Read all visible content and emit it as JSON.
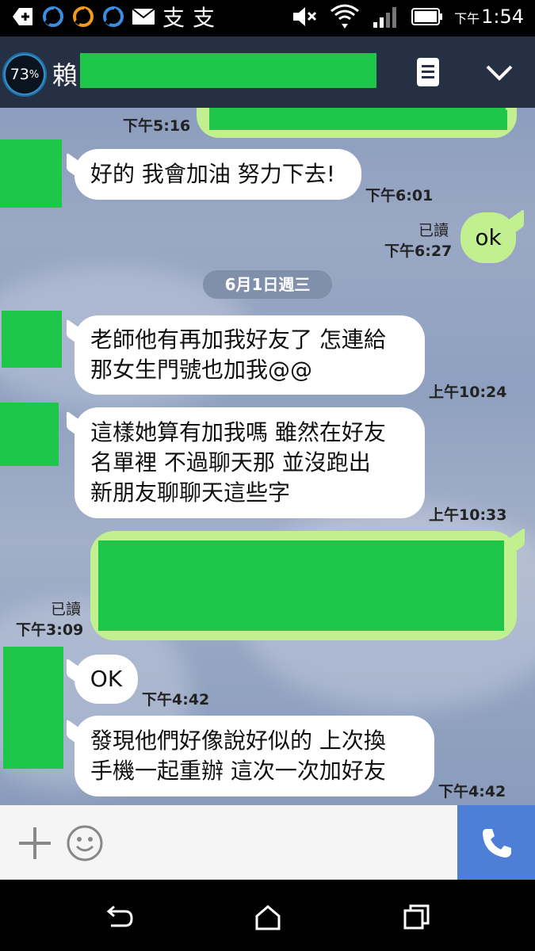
{
  "status_bar": {
    "ampm": "下午",
    "time": "1:54",
    "kanji_icons": [
      "支",
      "支"
    ]
  },
  "header": {
    "battery_value": "73",
    "battery_unit": "%",
    "contact_name": "賴"
  },
  "chat": {
    "top_time": "下午5:16",
    "date_separator": "6月1日週三",
    "messages": [
      {
        "text": "好的 我會加油 努力下去!",
        "time": "下午6:01"
      },
      {
        "text": "ok",
        "time": "下午6:27",
        "read": "已讀"
      },
      {
        "text": "老師他有再加我好友了 怎連給那女生門號也加我@@",
        "lines": [
          "老師他有再加我好友了 怎連給",
          "那女生門號也加我@@"
        ],
        "time": "上午10:24"
      },
      {
        "text": "這樣她算有加我嗎 雖然在好友名單裡 不過聊天那 並沒跑出新朋友聊聊天這些字",
        "lines": [
          "這樣她算有加我嗎 雖然在好友",
          "名單裡 不過聊天那 並沒跑出",
          "新朋友聊聊天這些字"
        ],
        "time": "上午10:33"
      },
      {
        "text": "",
        "time": "下午3:09",
        "read": "已讀"
      },
      {
        "text": "OK",
        "time": "下午4:42"
      },
      {
        "text": "發現他們好像說好似的 上次換手機一起重辦 這次一次加好友",
        "lines": [
          "發現他們好像說好似的 上次換",
          "手機一起重辦 這次一次加好友"
        ],
        "time": "下午4:42"
      }
    ]
  },
  "colors": {
    "header_bg": "#263044",
    "outgoing_bubble": "#c2ef8f",
    "redaction_green": "#1ec74a",
    "call_button": "#4e7fd6"
  }
}
